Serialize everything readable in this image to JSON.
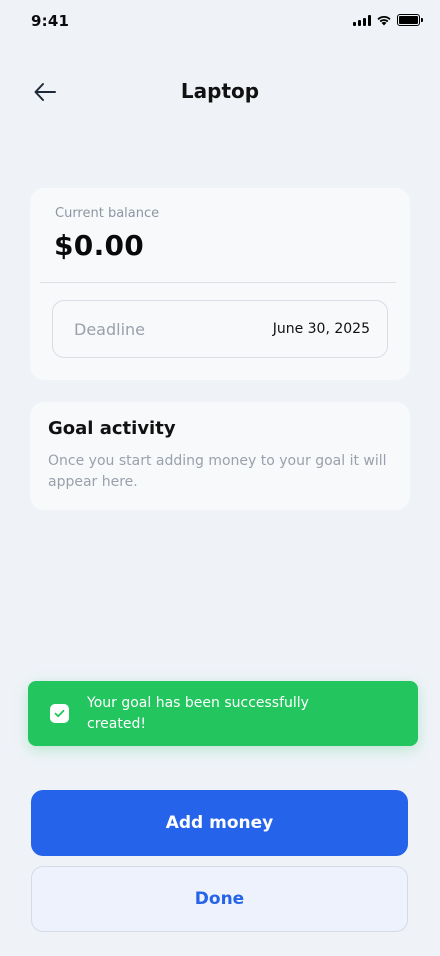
{
  "status_bar": {
    "time": "9:41",
    "icons": [
      "cellular-signal-icon",
      "wifi-icon",
      "battery-icon"
    ]
  },
  "header": {
    "back_icon": "arrow-left-icon",
    "title": "Laptop"
  },
  "balance_card": {
    "label": "Current balance",
    "value": "$0.00",
    "deadline": {
      "label": "Deadline",
      "value": "June 30, 2025"
    }
  },
  "activity": {
    "title": "Goal activity",
    "empty_text": "Once you start adding money to your goal it will appear here."
  },
  "toast": {
    "icon": "checkbox-check-icon",
    "message": "Your goal has been successfully created!"
  },
  "actions": {
    "add_money_label": "Add money",
    "done_label": "Done"
  },
  "colors": {
    "background": "#eff3f8",
    "primary": "#2563eb",
    "success": "#22c55e",
    "muted_text": "#9aa1ac"
  }
}
